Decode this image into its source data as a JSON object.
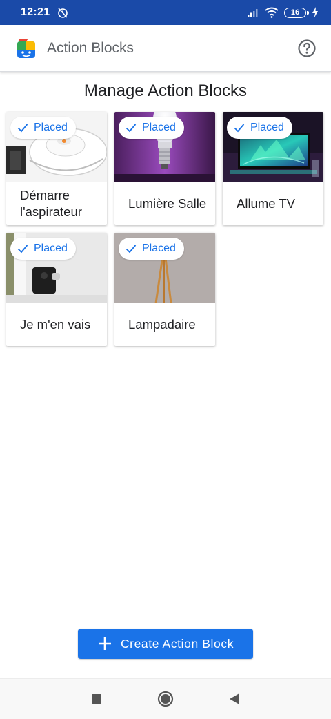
{
  "status_bar": {
    "time": "12:21",
    "battery_level": "16",
    "icons": [
      "alarm-off-icon",
      "signal-icon",
      "wifi-icon",
      "battery-icon",
      "charging-icon"
    ]
  },
  "app_bar": {
    "title": "Action Blocks",
    "help_icon": "help-circle-icon"
  },
  "page": {
    "title": "Manage Action Blocks"
  },
  "blocks": [
    {
      "label": "Démarre l'aspirateur",
      "status": "Placed",
      "image": "robot-vacuum"
    },
    {
      "label": "Lumière Salle",
      "status": "Placed",
      "image": "smart-bulb"
    },
    {
      "label": "Allume TV",
      "status": "Placed",
      "image": "tv"
    },
    {
      "label": "Je m'en vais",
      "status": "Placed",
      "image": "smart-lock"
    },
    {
      "label": "Lampadaire",
      "status": "Placed",
      "image": "floor-lamp"
    }
  ],
  "create_button": {
    "label": "Create Action Block",
    "icon": "plus-icon"
  },
  "nav_bar": {
    "icons": [
      "recents-square-icon",
      "home-circle-icon",
      "back-triangle-icon"
    ]
  },
  "colors": {
    "status_bar": "#1a4aa8",
    "accent": "#1a73e8"
  }
}
